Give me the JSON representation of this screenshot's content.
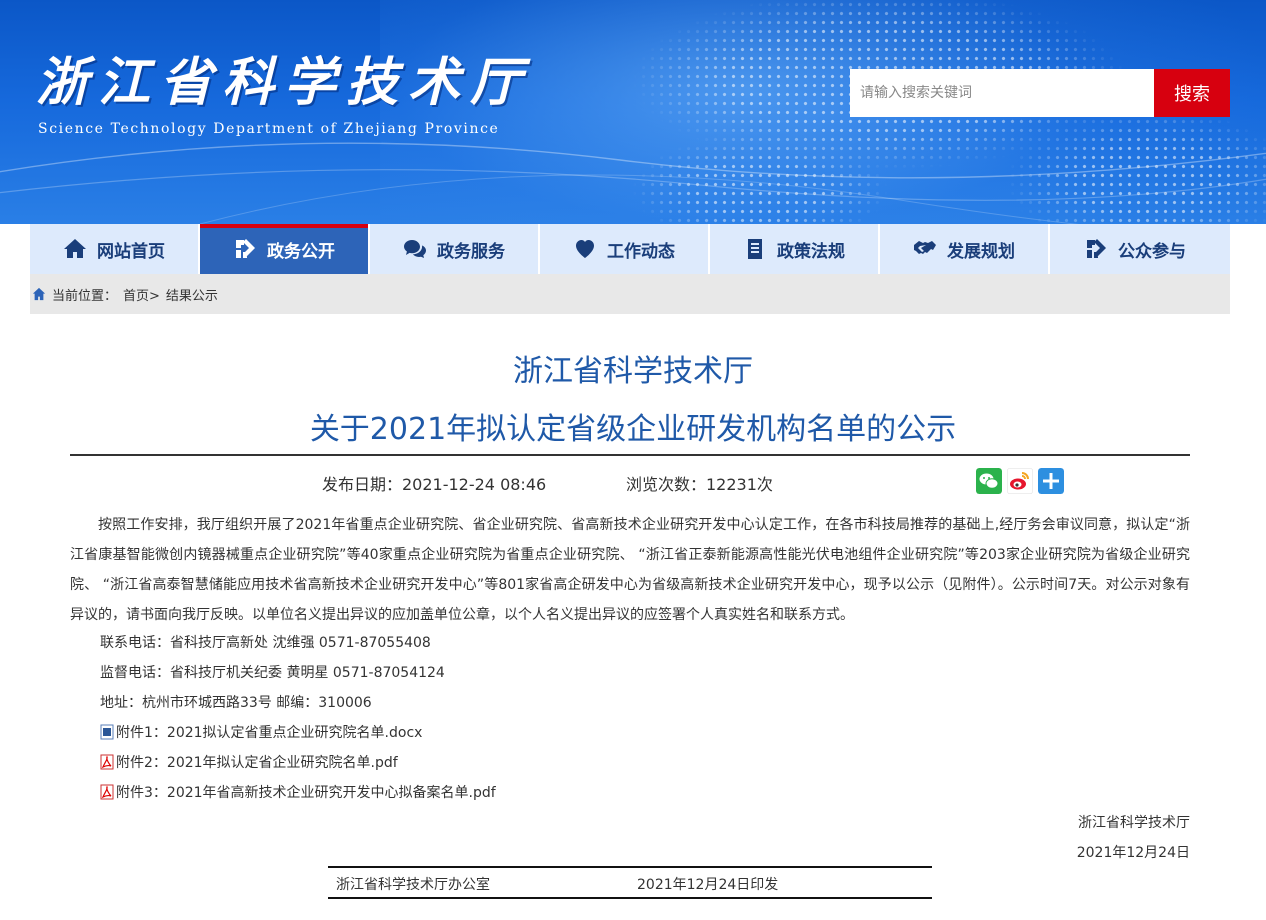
{
  "header": {
    "site_title": "浙江省科学技术厅",
    "site_subtitle": "Science Technology Department of Zhejiang Province",
    "search_placeholder": "请输入搜索关键词",
    "search_button": "搜索"
  },
  "nav": [
    {
      "label": "网站首页",
      "icon": "home-icon"
    },
    {
      "label": "政务公开",
      "icon": "open-affairs-icon",
      "active": true
    },
    {
      "label": "政务服务",
      "icon": "chat-icon"
    },
    {
      "label": "工作动态",
      "icon": "heart-icon"
    },
    {
      "label": "政策法规",
      "icon": "document-icon"
    },
    {
      "label": "发展规划",
      "icon": "handshake-icon"
    },
    {
      "label": "公众参与",
      "icon": "participate-icon"
    }
  ],
  "breadcrumb": {
    "prefix": "当前位置：",
    "home": "首页>",
    "current": "结果公示"
  },
  "article": {
    "org": "浙江省科学技术厅",
    "title": "关于2021年拟认定省级企业研发机构名单的公示",
    "date_label": "发布日期：2021-12-24 08:46",
    "views_label": "浏览次数：12231次",
    "paragraph": "按照工作安排，我厅组织开展了2021年省重点企业研究院、省企业研究院、省高新技术企业研究开发中心认定工作，在各市科技局推荐的基础上,经厅务会审议同意，拟认定“浙江省康基智能微创内镜器械重点企业研究院”等40家重点企业研究院为省重点企业研究院、 “浙江省正泰新能源高性能光伏电池组件企业研究院”等203家企业研究院为省级企业研究院、 “浙江省高泰智慧储能应用技术省高新技术企业研究开发中心”等801家省高企研发中心为省级高新技术企业研究开发中心，现予以公示（见附件）。公示时间7天。对公示对象有异议的，请书面向我厅反映。以单位名义提出异议的应加盖单位公章，以个人名义提出异议的应签署个人真实姓名和联系方式。",
    "contact": "联系电话：省科技厅高新处  沈维强 0571-87055408",
    "supervise": "监督电话：省科技厅机关纪委 黄明星 0571-87054124",
    "address": "地址：杭州市环城西路33号   邮编：310006",
    "attachments": [
      {
        "label": "附件1：2021拟认定省重点企业研究院名单.docx",
        "type": "docx"
      },
      {
        "label": "附件2：2021年拟认定省企业研究院名单.pdf",
        "type": "pdf"
      },
      {
        "label": "附件3：2021年省高新技术企业研究开发中心拟备案名单.pdf",
        "type": "pdf"
      }
    ],
    "signature_org": "浙江省科学技术厅",
    "signature_date": "2021年12月24日",
    "footer_office": "浙江省科学技术厅办公室",
    "footer_date": "2021年12月24日印发"
  },
  "colors": {
    "banner": "#1669dc",
    "search_button": "#d7000f",
    "nav_bg": "#ddeafc",
    "nav_active": "#2d64b8",
    "title": "#1f59a8"
  }
}
